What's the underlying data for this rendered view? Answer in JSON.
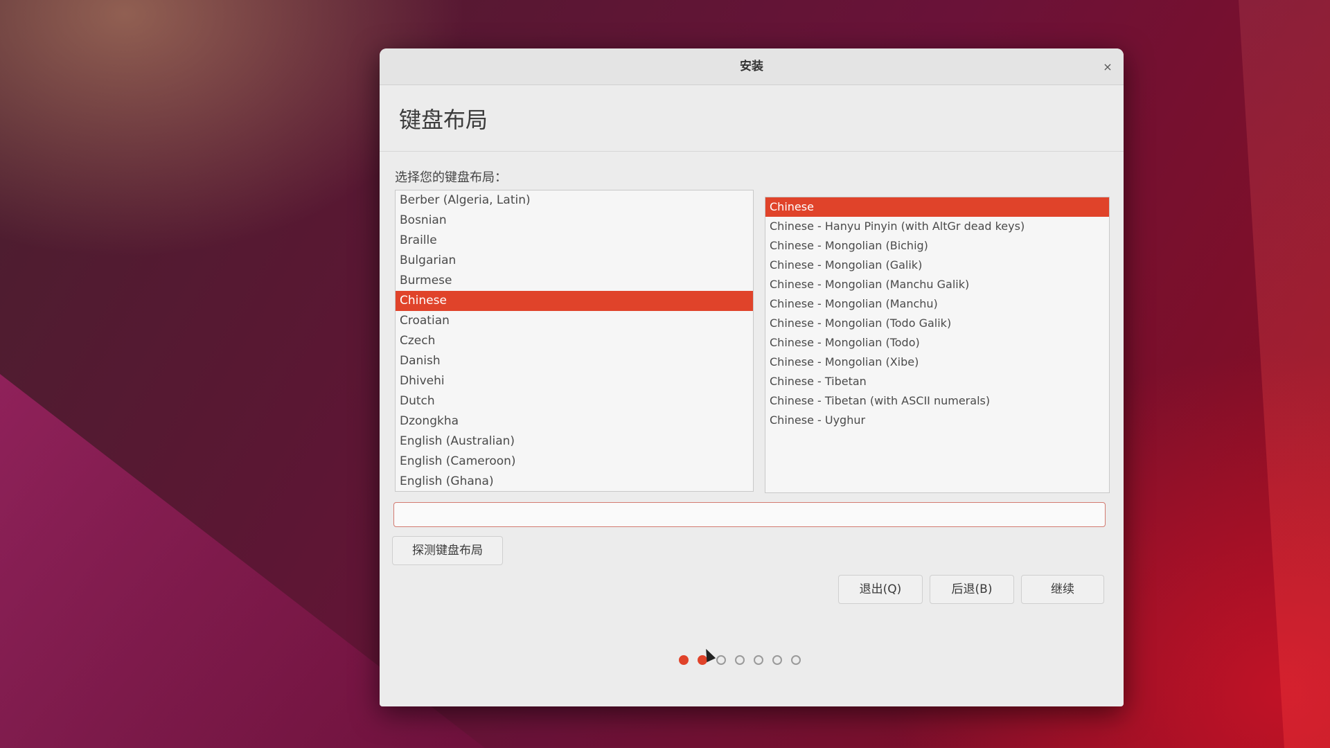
{
  "window": {
    "title": "安装",
    "close_symbol": "×",
    "page_title": "键盘布局",
    "prompt": "选择您的键盘布局："
  },
  "layouts": {
    "items": [
      "Berber (Algeria, Latin)",
      "Bosnian",
      "Braille",
      "Bulgarian",
      "Burmese",
      "Chinese",
      "Croatian",
      "Czech",
      "Danish",
      "Dhivehi",
      "Dutch",
      "Dzongkha",
      "English (Australian)",
      "English (Cameroon)",
      "English (Ghana)"
    ],
    "selected": "Chinese"
  },
  "variants": {
    "items": [
      "Chinese",
      "Chinese - Hanyu Pinyin (with AltGr dead keys)",
      "Chinese - Mongolian (Bichig)",
      "Chinese - Mongolian (Galik)",
      "Chinese - Mongolian (Manchu Galik)",
      "Chinese - Mongolian (Manchu)",
      "Chinese - Mongolian (Todo Galik)",
      "Chinese - Mongolian (Todo)",
      "Chinese - Mongolian (Xibe)",
      "Chinese - Tibetan",
      "Chinese - Tibetan (with ASCII numerals)",
      "Chinese - Uyghur"
    ],
    "selected": "Chinese"
  },
  "test_input": {
    "value": "",
    "placeholder": ""
  },
  "buttons": {
    "detect": "探测键盘布局",
    "quit": "退出(Q)",
    "back": "后退(B)",
    "continue": "继续"
  },
  "progress": {
    "total_steps": 7,
    "completed_steps": 2
  },
  "colors": {
    "accent": "#e0432a"
  }
}
